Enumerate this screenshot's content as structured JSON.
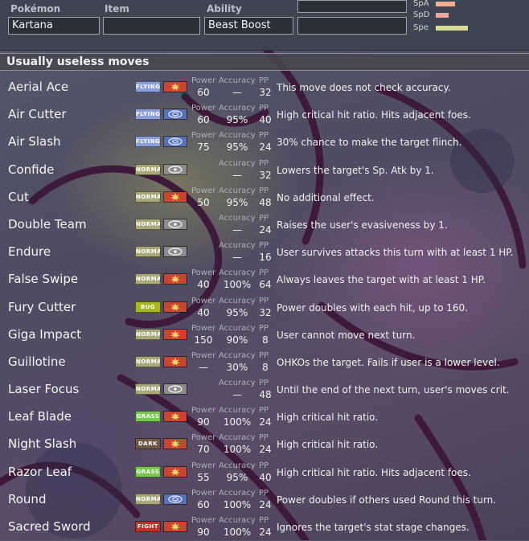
{
  "details": {
    "pokemon_label": "Pokémon",
    "pokemon_value": "Kartana",
    "item_label": "Item",
    "item_value": "",
    "ability_label": "Ability",
    "ability_value": "Beast Boost"
  },
  "stats": [
    {
      "name": "SpA",
      "level": 0.16,
      "color": "#f0b090"
    },
    {
      "name": "SpD",
      "level": 0.11,
      "color": "#f0a898"
    },
    {
      "name": "Spe",
      "level": 0.27,
      "color": "#d8dc9a"
    }
  ],
  "group": {
    "title": "Usually useless moves"
  },
  "column_labels": {
    "power": "Power",
    "accuracy": "Accuracy",
    "pp": "PP"
  },
  "moves": [
    {
      "name": "Aerial Ace",
      "type": "FLYING",
      "category": "physical",
      "power": "60",
      "accuracy": "—",
      "pp": "32",
      "desc": "This move does not check accuracy."
    },
    {
      "name": "Air Cutter",
      "type": "FLYING",
      "category": "special",
      "power": "60",
      "accuracy": "95%",
      "pp": "40",
      "desc": "High critical hit ratio. Hits adjacent foes."
    },
    {
      "name": "Air Slash",
      "type": "FLYING",
      "category": "special",
      "power": "75",
      "accuracy": "95%",
      "pp": "24",
      "desc": "30% chance to make the target flinch."
    },
    {
      "name": "Confide",
      "type": "NORMAL",
      "category": "status",
      "power": "",
      "accuracy": "—",
      "pp": "32",
      "desc": "Lowers the target's Sp. Atk by 1."
    },
    {
      "name": "Cut",
      "type": "NORMAL",
      "category": "physical",
      "power": "50",
      "accuracy": "95%",
      "pp": "48",
      "desc": "No additional effect."
    },
    {
      "name": "Double Team",
      "type": "NORMAL",
      "category": "status",
      "power": "",
      "accuracy": "—",
      "pp": "24",
      "desc": "Raises the user's evasiveness by 1."
    },
    {
      "name": "Endure",
      "type": "NORMAL",
      "category": "status",
      "power": "",
      "accuracy": "—",
      "pp": "16",
      "desc": "User survives attacks this turn with at least 1 HP."
    },
    {
      "name": "False Swipe",
      "type": "NORMAL",
      "category": "physical",
      "power": "40",
      "accuracy": "100%",
      "pp": "64",
      "desc": "Always leaves the target with at least 1 HP."
    },
    {
      "name": "Fury Cutter",
      "type": "BUG",
      "category": "physical",
      "power": "40",
      "accuracy": "95%",
      "pp": "32",
      "desc": "Power doubles with each hit, up to 160."
    },
    {
      "name": "Giga Impact",
      "type": "NORMAL",
      "category": "physical",
      "power": "150",
      "accuracy": "90%",
      "pp": "8",
      "desc": "User cannot move next turn."
    },
    {
      "name": "Guillotine",
      "type": "NORMAL",
      "category": "physical",
      "power": "—",
      "accuracy": "30%",
      "pp": "8",
      "desc": "OHKOs the target. Fails if user is a lower level."
    },
    {
      "name": "Laser Focus",
      "type": "NORMAL",
      "category": "status",
      "power": "",
      "accuracy": "—",
      "pp": "48",
      "desc": "Until the end of the next turn, user's moves crit."
    },
    {
      "name": "Leaf Blade",
      "type": "GRASS",
      "category": "physical",
      "power": "90",
      "accuracy": "100%",
      "pp": "24",
      "desc": "High critical hit ratio."
    },
    {
      "name": "Night Slash",
      "type": "DARK",
      "category": "physical",
      "power": "70",
      "accuracy": "100%",
      "pp": "24",
      "desc": "High critical hit ratio."
    },
    {
      "name": "Razor Leaf",
      "type": "GRASS",
      "category": "physical",
      "power": "55",
      "accuracy": "95%",
      "pp": "40",
      "desc": "High critical hit ratio. Hits adjacent foes."
    },
    {
      "name": "Round",
      "type": "NORMAL",
      "category": "special",
      "power": "60",
      "accuracy": "100%",
      "pp": "24",
      "desc": "Power doubles if others used Round this turn."
    },
    {
      "name": "Sacred Sword",
      "type": "FIGHT",
      "category": "physical",
      "power": "90",
      "accuracy": "100%",
      "pp": "24",
      "desc": "Ignores the target's stat stage changes."
    }
  ],
  "type_colors": {
    "FLYING": "#8c9fd8",
    "NORMAL": "#a8a878",
    "BUG": "#a8b820",
    "GRASS": "#78c850",
    "DARK": "#705848",
    "FIGHT": "#c03028"
  }
}
